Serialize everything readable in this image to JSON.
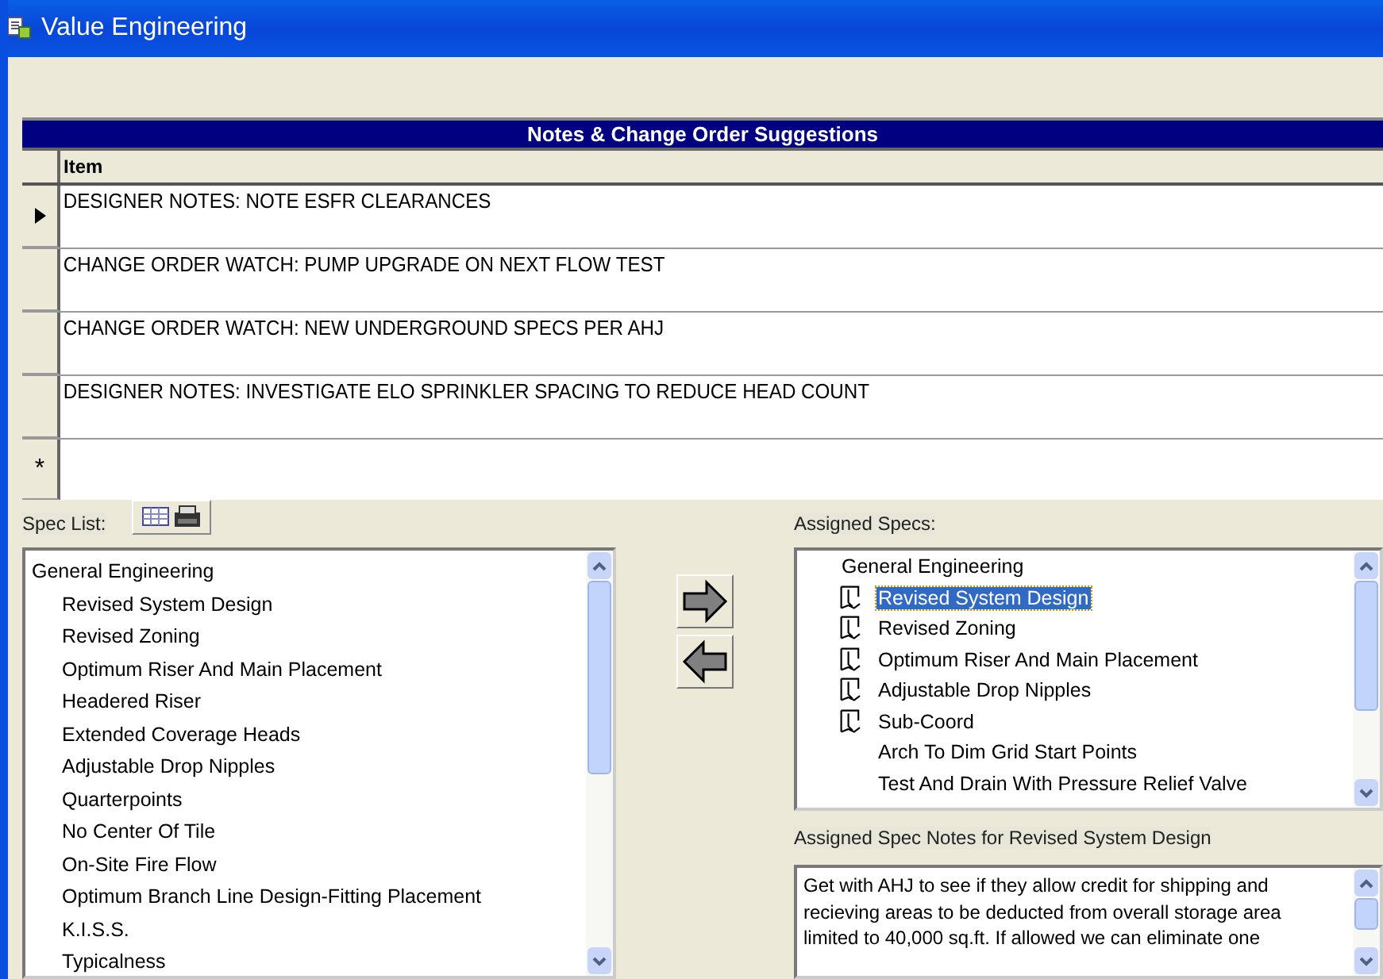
{
  "window": {
    "title": "Value Engineering"
  },
  "grid": {
    "title": "Notes & Change Order Suggestions",
    "column": "Item",
    "rows": [
      {
        "text": "DESIGNER NOTES: NOTE ESFR CLEARANCES",
        "current": true
      },
      {
        "text": "CHANGE ORDER WATCH: PUMP UPGRADE ON NEXT FLOW TEST",
        "current": false
      },
      {
        "text": "CHANGE ORDER WATCH: NEW UNDERGROUND SPECS PER AHJ",
        "current": false
      },
      {
        "text": "DESIGNER NOTES: INVESTIGATE ELO SPRINKLER SPACING TO REDUCE HEAD COUNT",
        "current": false
      }
    ],
    "new_row_marker": "*"
  },
  "spec_list": {
    "label": "Spec List:",
    "group": "General Engineering",
    "items": [
      "Revised System Design",
      "Revised Zoning",
      "Optimum Riser And Main Placement",
      "Headered Riser",
      "Extended Coverage Heads",
      "Adjustable Drop Nipples",
      "Quarterpoints",
      "No Center Of Tile",
      "On-Site Fire Flow",
      "Optimum Branch Line Design-Fitting Placement",
      "K.I.S.S.",
      "Typicalness"
    ]
  },
  "assigned_specs": {
    "label": "Assigned Specs:",
    "group": "General Engineering",
    "items": [
      {
        "text": "Revised System Design",
        "noted": true,
        "selected": true
      },
      {
        "text": "Revised Zoning",
        "noted": true,
        "selected": false
      },
      {
        "text": "Optimum Riser And Main Placement",
        "noted": true,
        "selected": false
      },
      {
        "text": "Adjustable Drop Nipples",
        "noted": true,
        "selected": false
      },
      {
        "text": "Sub-Coord",
        "noted": true,
        "selected": false
      },
      {
        "text": "Arch To Dim Grid Start Points",
        "noted": false,
        "selected": false
      },
      {
        "text": "Test And Drain With Pressure Relief Valve",
        "noted": false,
        "selected": false
      }
    ]
  },
  "notes": {
    "label": "Assigned Spec Notes for Revised System Design",
    "value": "Get with AHJ to see if they allow credit for shipping and recieving areas to be deducted from overall storage area limited to 40,000 sq.ft. If allowed we can eliminate one"
  }
}
